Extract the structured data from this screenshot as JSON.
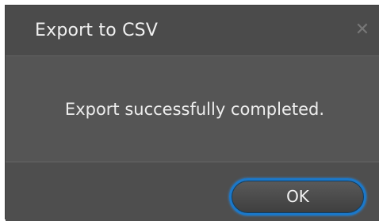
{
  "dialog": {
    "title": "Export to CSV",
    "close_icon": "close-icon",
    "close_glyph": "✕",
    "message": "Export successfully completed.",
    "ok_label": "OK"
  },
  "colors": {
    "dialog_background": "#505050",
    "accent_border": "#1b78c9",
    "text": "#f0f0f0"
  }
}
